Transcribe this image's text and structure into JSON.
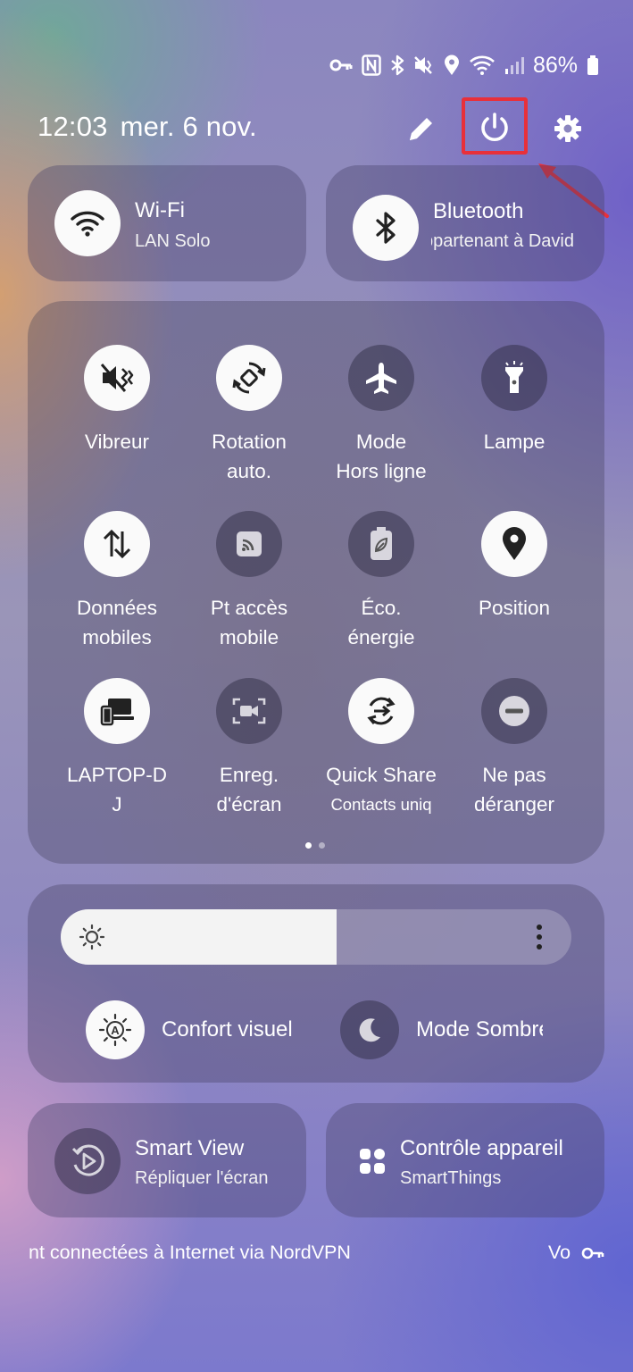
{
  "status_bar": {
    "battery_percent": "86%",
    "icons": [
      "vpn-key-icon",
      "nfc-icon",
      "bluetooth-icon",
      "mute-icon",
      "location-icon",
      "wifi-icon",
      "signal-icon",
      "battery-icon"
    ]
  },
  "header": {
    "time": "12:03",
    "date": "mer. 6 nov.",
    "icons": [
      "pencil-icon",
      "power-icon",
      "gear-icon"
    ],
    "highlight_color": "#e8303a"
  },
  "wifi_tile": {
    "title": "Wi-Fi",
    "subtitle": "LAN Solo",
    "active": true
  },
  "bluetooth_tile": {
    "title": "Bluetooth",
    "subtitle": "appartenant à David",
    "active": true
  },
  "quick_settings": [
    {
      "line1": "Vibreur",
      "line2": "",
      "icon": "vibrate-icon",
      "active": true
    },
    {
      "line1": "Rotation",
      "line2": "auto.",
      "icon": "rotation-icon",
      "active": true
    },
    {
      "line1": "Mode",
      "line2": "Hors ligne",
      "icon": "airplane-icon",
      "active": false
    },
    {
      "line1": "Lampe",
      "line2": "",
      "icon": "flashlight-icon",
      "active": false
    },
    {
      "line1": "Données",
      "line2": "mobiles",
      "icon": "mobile-data-icon",
      "active": true
    },
    {
      "line1": "Pt accès",
      "line2": "mobile",
      "icon": "hotspot-icon",
      "active": false
    },
    {
      "line1": "Éco.",
      "line2": "énergie",
      "icon": "power-saving-icon",
      "active": false
    },
    {
      "line1": "Position",
      "line2": "",
      "icon": "location-pin-icon",
      "active": true
    },
    {
      "line1": "LAPTOP-D",
      "line2": "J",
      "icon": "devices-icon",
      "active": true
    },
    {
      "line1": "Enreg.",
      "line2": "d'écran",
      "icon": "screen-record-icon",
      "active": false
    },
    {
      "line1": "Quick Share",
      "line2": "Contacts uniq",
      "icon": "quick-share-icon",
      "active": true
    },
    {
      "line1": "Ne pas",
      "line2": "déranger",
      "icon": "do-not-disturb-icon",
      "active": false
    }
  ],
  "page_indicator": {
    "current": 1,
    "total": 2
  },
  "brightness": {
    "level": 0.54
  },
  "eye_comfort": {
    "label": "Confort visuel"
  },
  "dark_mode": {
    "label": "Mode Sombre"
  },
  "smart_view": {
    "title": "Smart View",
    "subtitle": "Répliquer l'écran"
  },
  "device_control": {
    "title": "Contrôle appareil",
    "subtitle": "SmartThings"
  },
  "footer": {
    "vpn_text": "nt connectées à Internet via NordVPN",
    "right_text": "Vo"
  }
}
